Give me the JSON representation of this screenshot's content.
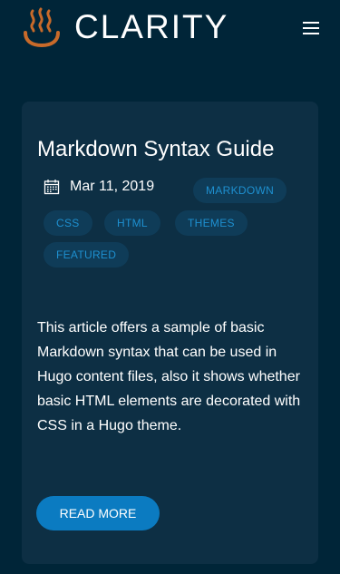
{
  "header": {
    "site_title": "CLARITY",
    "logo_icon": "hot-spring-icon",
    "menu_icon": "hamburger-icon",
    "logo_color": "#c86a2a"
  },
  "post": {
    "title": "Markdown Syntax Guide",
    "date": "Mar 11, 2019",
    "date_icon": "calendar-icon",
    "tags": [
      "MARKDOWN",
      "CSS",
      "HTML",
      "THEMES",
      "FEATURED"
    ],
    "excerpt": "This article offers a sample of basic Markdown syntax that can be used in Hugo content files, also it shows whether basic HTML elements are decorated with CSS in a Hugo theme.",
    "read_more_label": "READ MORE"
  },
  "colors": {
    "background": "#002538",
    "card": "#0d2f44",
    "tag_bg": "#0f3c58",
    "tag_text": "#1e90d0",
    "accent": "#0b7bc1"
  }
}
